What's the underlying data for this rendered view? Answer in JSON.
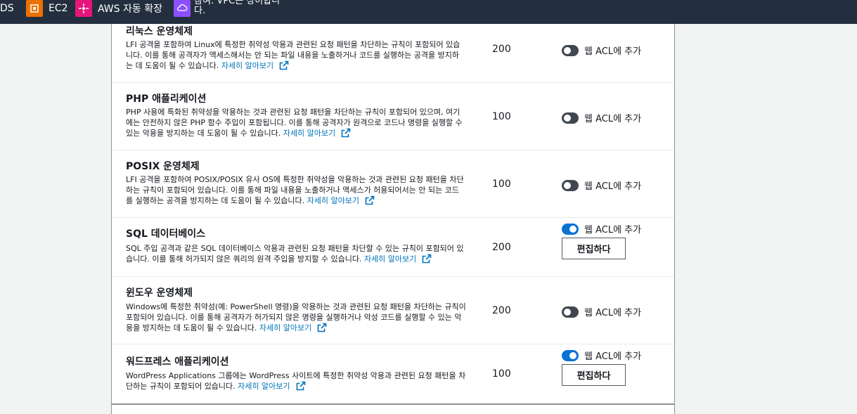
{
  "topbar": {
    "partial_left": "DS",
    "ec2_label": "EC2",
    "autoscaling_label": "AWS 자동 확장",
    "notice_line1": "참여: VPC는 상이합니",
    "notice_line2": "다.",
    "colors": {
      "ec2": "#ed7100",
      "autoscaling": "#e7157b",
      "vpc": "#8c4fff"
    }
  },
  "rules": [
    {
      "title": "리눅스 운영체제",
      "description": "LFI 공격을 포함하여 Linux에 특정한 취약성 악용과 관련된 요청 패턴을 차단하는 규칙이 포함되어 있습니다. 이를 통해 공격자가 액세스해서는 안 되는 파일 내용을 노출하거나 코드를 실행하는 공격을 방지하는 데 도움이 될 수 있습니다.",
      "link": "자세히 알아보기",
      "capacity": "200",
      "toggle_label": "웹 ACL에 추가",
      "enabled": false
    },
    {
      "title": "PHP 애플리케이션",
      "description": "PHP 사용에 특화된 취약성을 악용하는 것과 관련된 요청 패턴을 차단하는 규칙이 포함되어 있으며, 여기에는 안전하지 않은 PHP 함수 주입이 포함됩니다. 이를 통해 공격자가 원격으로 코드나 명령을 실행할 수 있는 악용을 방지하는 데 도움이 될 수 있습니다.",
      "link": "자세히 알아보기",
      "capacity": "100",
      "toggle_label": "웹 ACL에 추가",
      "enabled": false
    },
    {
      "title": "POSIX 운영체제",
      "description": "LFI 공격을 포함하여 POSIX/POSIX 유사 OS에 특정한 취약성을 악용하는 것과 관련된 요청 패턴을 차단하는 규칙이 포함되어 있습니다. 이를 통해 파일 내용을 노출하거나 액세스가 허용되어서는 안 되는 코드를 실행하는 공격을 방지하는 데 도움이 될 수 있습니다.",
      "link": "자세히 알아보기",
      "capacity": "100",
      "toggle_label": "웹 ACL에 추가",
      "enabled": false
    },
    {
      "title": "SQL 데이터베이스",
      "description": "SQL 주입 공격과 같은 SQL 데이터베이스 악용과 관련된 요청 패턴을 차단할 수 있는 규칙이 포함되어 있습니다. 이를 통해 허가되지 않은 쿼리의 원격 주입을 방지할 수 있습니다.",
      "link": "자세히 알아보기",
      "capacity": "200",
      "toggle_label": "웹 ACL에 추가",
      "enabled": true,
      "edit_label": "편집하다"
    },
    {
      "title": "윈도우 운영체제",
      "description": "Windows에 특정한 취약성(예: PowerShell 명령)을 악용하는 것과 관련된 요청 패턴을 차단하는 규칙이 포함되어 있습니다. 이를 통해 공격자가 허가되지 않은 명령을 실행하거나 악성 코드를 실행할 수 있는 악용을 방지하는 데 도움이 될 수 있습니다.",
      "link": "자세히 알아보기",
      "capacity": "200",
      "toggle_label": "웹 ACL에 추가",
      "enabled": false
    },
    {
      "title": "워드프레스 애플리케이션",
      "description": "WordPress Applications 그룹에는 WordPress 사이트에 특정한 취약성 악용과 관련된 요청 패턴을 차단하는 규칙이 포함되어 있습니다.",
      "link": "자세히 알아보기",
      "capacity": "100",
      "toggle_label": "웹 ACL에 추가",
      "enabled": true,
      "edit_label": "편집하다"
    }
  ]
}
